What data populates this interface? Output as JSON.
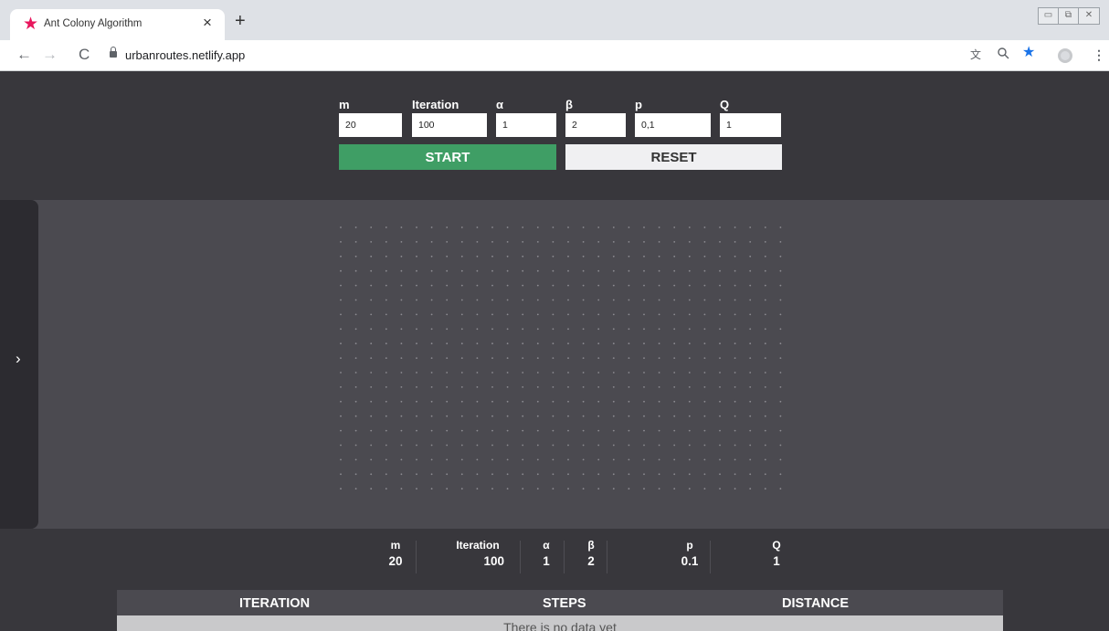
{
  "browser": {
    "tab_title": "Ant Colony Algorithm",
    "url": "urbanroutes.netlify.app"
  },
  "params": {
    "m": {
      "label": "m",
      "value": "20"
    },
    "iteration": {
      "label": "Iteration",
      "value": "100"
    },
    "alpha": {
      "label": "α",
      "value": "1"
    },
    "beta": {
      "label": "β",
      "value": "2"
    },
    "p": {
      "label": "p",
      "value": "0,1"
    },
    "q": {
      "label": "Q",
      "value": "1"
    }
  },
  "buttons": {
    "start": "START",
    "reset": "RESET"
  },
  "summary": {
    "m": {
      "label": "m",
      "value": "20"
    },
    "iteration": {
      "label": "Iteration",
      "value": "100"
    },
    "alpha": {
      "label": "α",
      "value": "1"
    },
    "beta": {
      "label": "β",
      "value": "2"
    },
    "p": {
      "label": "p",
      "value": "0.1"
    },
    "q": {
      "label": "Q",
      "value": "1"
    }
  },
  "table": {
    "columns": [
      "ITERATION",
      "STEPS",
      "DISTANCE"
    ],
    "empty_message": "There is no data yet"
  },
  "colors": {
    "start": "#3f9e65",
    "reset": "#f0f0f2",
    "favicon": "#e8175d"
  }
}
